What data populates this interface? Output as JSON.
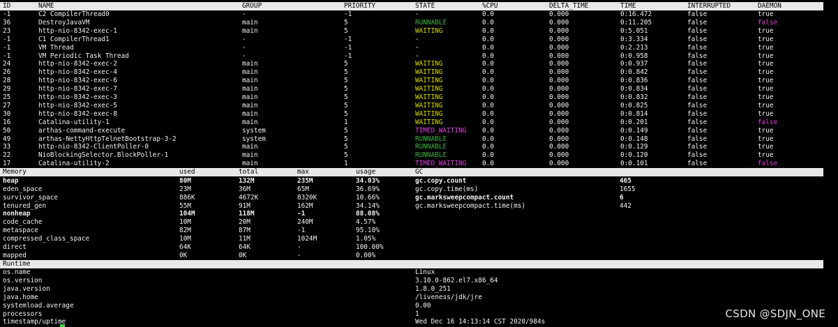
{
  "threads": {
    "headers": [
      "ID",
      "NAME",
      "GROUP",
      "PRIORITY",
      "STATE",
      "%CPU",
      "DELTA_TIME",
      "TIME",
      "INTERRUPTED",
      "DAEMON"
    ],
    "rows": [
      [
        "-1",
        "C2 CompilerThread0",
        "-",
        "-1",
        "-",
        "0.0",
        "0.000",
        "0:16.472",
        "false",
        "true"
      ],
      [
        "36",
        "DestroyJavaVM",
        "main",
        "5",
        "RUNNABLE",
        "0.0",
        "0.000",
        "0:11.205",
        "false",
        "false"
      ],
      [
        "23",
        "http-nio-8342-exec-1",
        "main",
        "5",
        "WAITING",
        "0.0",
        "0.000",
        "0:5.051",
        "false",
        "true"
      ],
      [
        "-1",
        "C1 CompilerThread1",
        "-",
        "-1",
        "-",
        "0.0",
        "0.000",
        "0:3.334",
        "false",
        "true"
      ],
      [
        "-1",
        "VM Thread",
        "-",
        "-1",
        "-",
        "0.0",
        "0.000",
        "0:2.213",
        "false",
        "true"
      ],
      [
        "-1",
        "VM Periodic Task Thread",
        "-",
        "-1",
        "-",
        "0.0",
        "0.000",
        "0:0.958",
        "false",
        "true"
      ],
      [
        "24",
        "http-nio-8342-exec-2",
        "main",
        "5",
        "WAITING",
        "0.0",
        "0.000",
        "0:0.937",
        "false",
        "true"
      ],
      [
        "26",
        "http-nio-8342-exec-4",
        "main",
        "5",
        "WAITING",
        "0.0",
        "0.000",
        "0:0.842",
        "false",
        "true"
      ],
      [
        "28",
        "http-nio-8342-exec-6",
        "main",
        "5",
        "WAITING",
        "0.0",
        "0.000",
        "0:0.836",
        "false",
        "true"
      ],
      [
        "29",
        "http-nio-8342-exec-7",
        "main",
        "5",
        "WAITING",
        "0.0",
        "0.000",
        "0:0.834",
        "false",
        "true"
      ],
      [
        "25",
        "http-nio-8342-exec-3",
        "main",
        "5",
        "WAITING",
        "0.0",
        "0.000",
        "0:0.832",
        "false",
        "true"
      ],
      [
        "27",
        "http-nio-8342-exec-5",
        "main",
        "5",
        "WAITING",
        "0.0",
        "0.000",
        "0:0.825",
        "false",
        "true"
      ],
      [
        "30",
        "http-nio-8342-exec-8",
        "main",
        "5",
        "WAITING",
        "0.0",
        "0.000",
        "0:0.814",
        "false",
        "true"
      ],
      [
        "16",
        "Catalina-utility-1",
        "main",
        "1",
        "WAITING",
        "0.0",
        "0.000",
        "0:0.201",
        "false",
        "false"
      ],
      [
        "50",
        "arthas-command-execute",
        "system",
        "5",
        "TIMED_WAITING",
        "0.0",
        "0.000",
        "0:0.149",
        "false",
        "true"
      ],
      [
        "49",
        "arthas-NettyHttpTelnetBootstrap-3-2",
        "system",
        "5",
        "RUNNABLE",
        "0.0",
        "0.000",
        "0:0.148",
        "false",
        "true"
      ],
      [
        "33",
        "http-nio-8342-ClientPoller-0",
        "main",
        "5",
        "RUNNABLE",
        "0.0",
        "0.000",
        "0:0.129",
        "false",
        "true"
      ],
      [
        "22",
        "NioBlockingSelector.BlockPoller-1",
        "main",
        "5",
        "RUNNABLE",
        "0.0",
        "0.000",
        "0:0.120",
        "false",
        "true"
      ],
      [
        "17",
        "Catalina-utility-2",
        "main",
        "1",
        "TIMED_WAITING",
        "0.0",
        "0.000",
        "0:0.101",
        "false",
        "false"
      ]
    ]
  },
  "memory": {
    "headers": [
      "Memory",
      "used",
      "total",
      "max",
      "usage",
      "GC"
    ],
    "rows": [
      {
        "cells": [
          "heap",
          "80M",
          "132M",
          "235M",
          "34.03%"
        ],
        "bold": true
      },
      {
        "cells": [
          "eden_space",
          "23M",
          "36M",
          "65M",
          "36.69%"
        ],
        "bold": false
      },
      {
        "cells": [
          "survivor_space",
          "886K",
          "4672K",
          "8320K",
          "10.66%"
        ],
        "bold": false
      },
      {
        "cells": [
          "tenured_gen",
          "55M",
          "91M",
          "162M",
          "34.14%"
        ],
        "bold": false
      },
      {
        "cells": [
          "nonheap",
          "104M",
          "118M",
          "-1",
          "88.08%"
        ],
        "bold": true
      },
      {
        "cells": [
          "code_cache",
          "10M",
          "20M",
          "240M",
          "4.57%"
        ],
        "bold": false
      },
      {
        "cells": [
          "metaspace",
          "82M",
          "87M",
          "-1",
          "95.10%"
        ],
        "bold": false
      },
      {
        "cells": [
          "compressed_class_space",
          "10M",
          "11M",
          "1024M",
          "1.05%"
        ],
        "bold": false
      },
      {
        "cells": [
          "direct",
          "64K",
          "64K",
          "-",
          "100.00%"
        ],
        "bold": false
      },
      {
        "cells": [
          "mapped",
          "0K",
          "0K",
          "-",
          "0.00%"
        ],
        "bold": false
      }
    ],
    "gc": [
      {
        "name": "gc.copy.count",
        "value": "465",
        "bold": true
      },
      {
        "name": "gc.copy.time(ms)",
        "value": "1655",
        "bold": false
      },
      {
        "name": "gc.marksweepcompact.count",
        "value": "6",
        "bold": true
      },
      {
        "name": "gc.marksweepcompact.time(ms)",
        "value": "442",
        "bold": false
      }
    ]
  },
  "runtime": {
    "header": "Runtime",
    "rows": [
      [
        "os.name",
        "Linux"
      ],
      [
        "os.version",
        "3.10.0-862.el7.x86_64"
      ],
      [
        "java.version",
        "1.8.0_251"
      ],
      [
        "java.home",
        "/liveness/jdk/jre"
      ],
      [
        "systemload.average",
        "0.00"
      ],
      [
        "processors",
        "1"
      ],
      [
        "timestamp/uptime",
        "Wed Dec 16 14:13:14 CST 2020/984s"
      ]
    ]
  },
  "watermark": "CSDN @SDJN_ONE",
  "colors": {
    "runnable": "#3fb43f",
    "waiting": "#d8d800",
    "timed_waiting": "#e040e0",
    "daemon_false": "#e040e0",
    "header_bg": "#e8e8e8",
    "background": "#000000"
  }
}
